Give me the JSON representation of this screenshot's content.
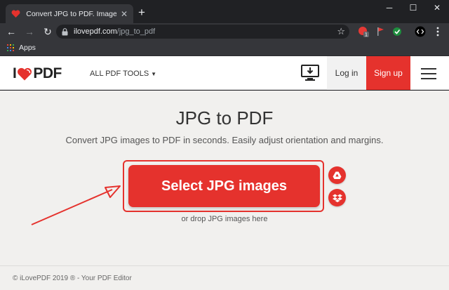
{
  "browser": {
    "tab_title": "Convert JPG to PDF. Images JPG to PDF",
    "tab_close": "✕",
    "new_tab": "+",
    "window": {
      "minimize": "─",
      "maximize": "☐",
      "close": "✕"
    },
    "nav": {
      "back": "←",
      "forward": "→",
      "reload": "↻"
    },
    "url_host": "ilovepdf.com",
    "url_path": "/jpg_to_pdf",
    "star": "☆",
    "bookmarks": {
      "apps_label": "Apps"
    },
    "extension_badge": "1"
  },
  "header": {
    "logo_left": "I",
    "logo_right": "PDF",
    "all_tools": "ALL PDF TOOLS",
    "caret": "▼",
    "login": "Log in",
    "signup": "Sign up"
  },
  "main": {
    "title": "JPG to PDF",
    "subtitle": "Convert JPG images to PDF in seconds. Easily adjust orientation and margins.",
    "select_button": "Select JPG images",
    "drop_text": "or drop JPG images here"
  },
  "footer": {
    "copyright": "© iLovePDF 2019 ® - Your PDF Editor"
  },
  "colors": {
    "brand_red": "#e5322d",
    "chrome_dark": "#202124",
    "chrome_toolbar": "#35363a",
    "page_bg": "#f1f0ee"
  }
}
